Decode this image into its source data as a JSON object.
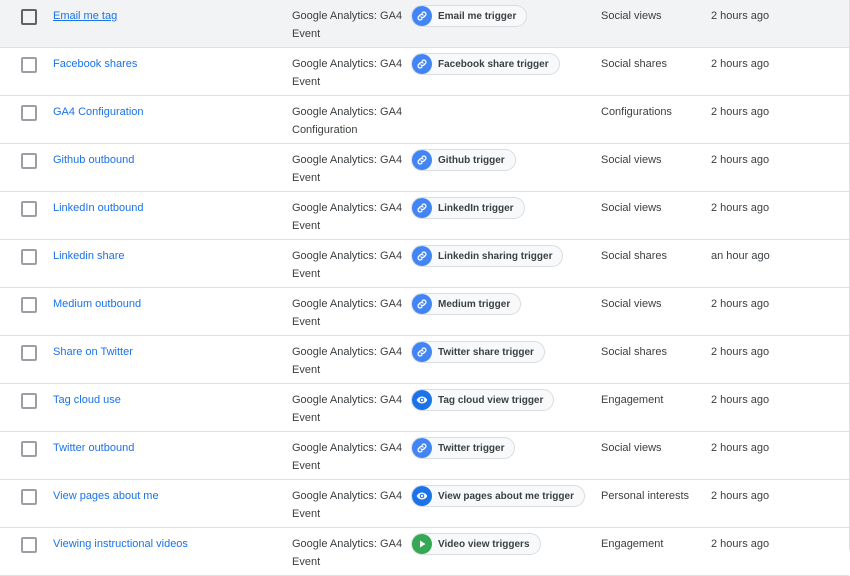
{
  "colors": {
    "link": "#1a73e8",
    "link_trigger_icon": "#4285f4",
    "eye_trigger_icon": "#1a73e8",
    "video_trigger_icon": "#34a853",
    "hover_row": "#f1f3f4"
  },
  "rows": [
    {
      "name": "Email me tag",
      "type_line1": "Google Analytics: GA4",
      "type_line2": "Event",
      "trigger": "Email me trigger",
      "trigger_icon": "link-icon",
      "folder": "Social views",
      "last_edited": "2 hours ago"
    },
    {
      "name": "Facebook shares",
      "type_line1": "Google Analytics: GA4",
      "type_line2": "Event",
      "trigger": "Facebook share trigger",
      "trigger_icon": "link-icon",
      "folder": "Social shares",
      "last_edited": "2 hours ago"
    },
    {
      "name": "GA4 Configuration",
      "type_line1": "Google Analytics: GA4",
      "type_line2": "Configuration",
      "trigger": "",
      "trigger_icon": "",
      "folder": "Configurations",
      "last_edited": "2 hours ago"
    },
    {
      "name": "Github outbound",
      "type_line1": "Google Analytics: GA4",
      "type_line2": "Event",
      "trigger": "Github trigger",
      "trigger_icon": "link-icon",
      "folder": "Social views",
      "last_edited": "2 hours ago"
    },
    {
      "name": "LinkedIn outbound",
      "type_line1": "Google Analytics: GA4",
      "type_line2": "Event",
      "trigger": "LinkedIn trigger",
      "trigger_icon": "link-icon",
      "folder": "Social views",
      "last_edited": "2 hours ago"
    },
    {
      "name": "Linkedin share",
      "type_line1": "Google Analytics: GA4",
      "type_line2": "Event",
      "trigger": "Linkedin sharing trigger",
      "trigger_icon": "link-icon",
      "folder": "Social shares",
      "last_edited": "an hour ago"
    },
    {
      "name": "Medium outbound",
      "type_line1": "Google Analytics: GA4",
      "type_line2": "Event",
      "trigger": "Medium trigger",
      "trigger_icon": "link-icon",
      "folder": "Social views",
      "last_edited": "2 hours ago"
    },
    {
      "name": "Share on Twitter",
      "type_line1": "Google Analytics: GA4",
      "type_line2": "Event",
      "trigger": "Twitter share trigger",
      "trigger_icon": "link-icon",
      "folder": "Social shares",
      "last_edited": "2 hours ago"
    },
    {
      "name": "Tag cloud use",
      "type_line1": "Google Analytics: GA4",
      "type_line2": "Event",
      "trigger": "Tag cloud view trigger",
      "trigger_icon": "eye-icon",
      "folder": "Engagement",
      "last_edited": "2 hours ago"
    },
    {
      "name": "Twitter outbound",
      "type_line1": "Google Analytics: GA4",
      "type_line2": "Event",
      "trigger": "Twitter trigger",
      "trigger_icon": "link-icon",
      "folder": "Social views",
      "last_edited": "2 hours ago"
    },
    {
      "name": "View pages about me",
      "type_line1": "Google Analytics: GA4",
      "type_line2": "Event",
      "trigger": "View pages about me trigger",
      "trigger_icon": "eye-icon",
      "folder": "Personal interests",
      "last_edited": "2 hours ago"
    },
    {
      "name": "Viewing instructional videos",
      "type_line1": "Google Analytics: GA4",
      "type_line2": "Event",
      "trigger": "Video view triggers",
      "trigger_icon": "play-icon",
      "folder": "Engagement",
      "last_edited": "2 hours ago"
    }
  ]
}
